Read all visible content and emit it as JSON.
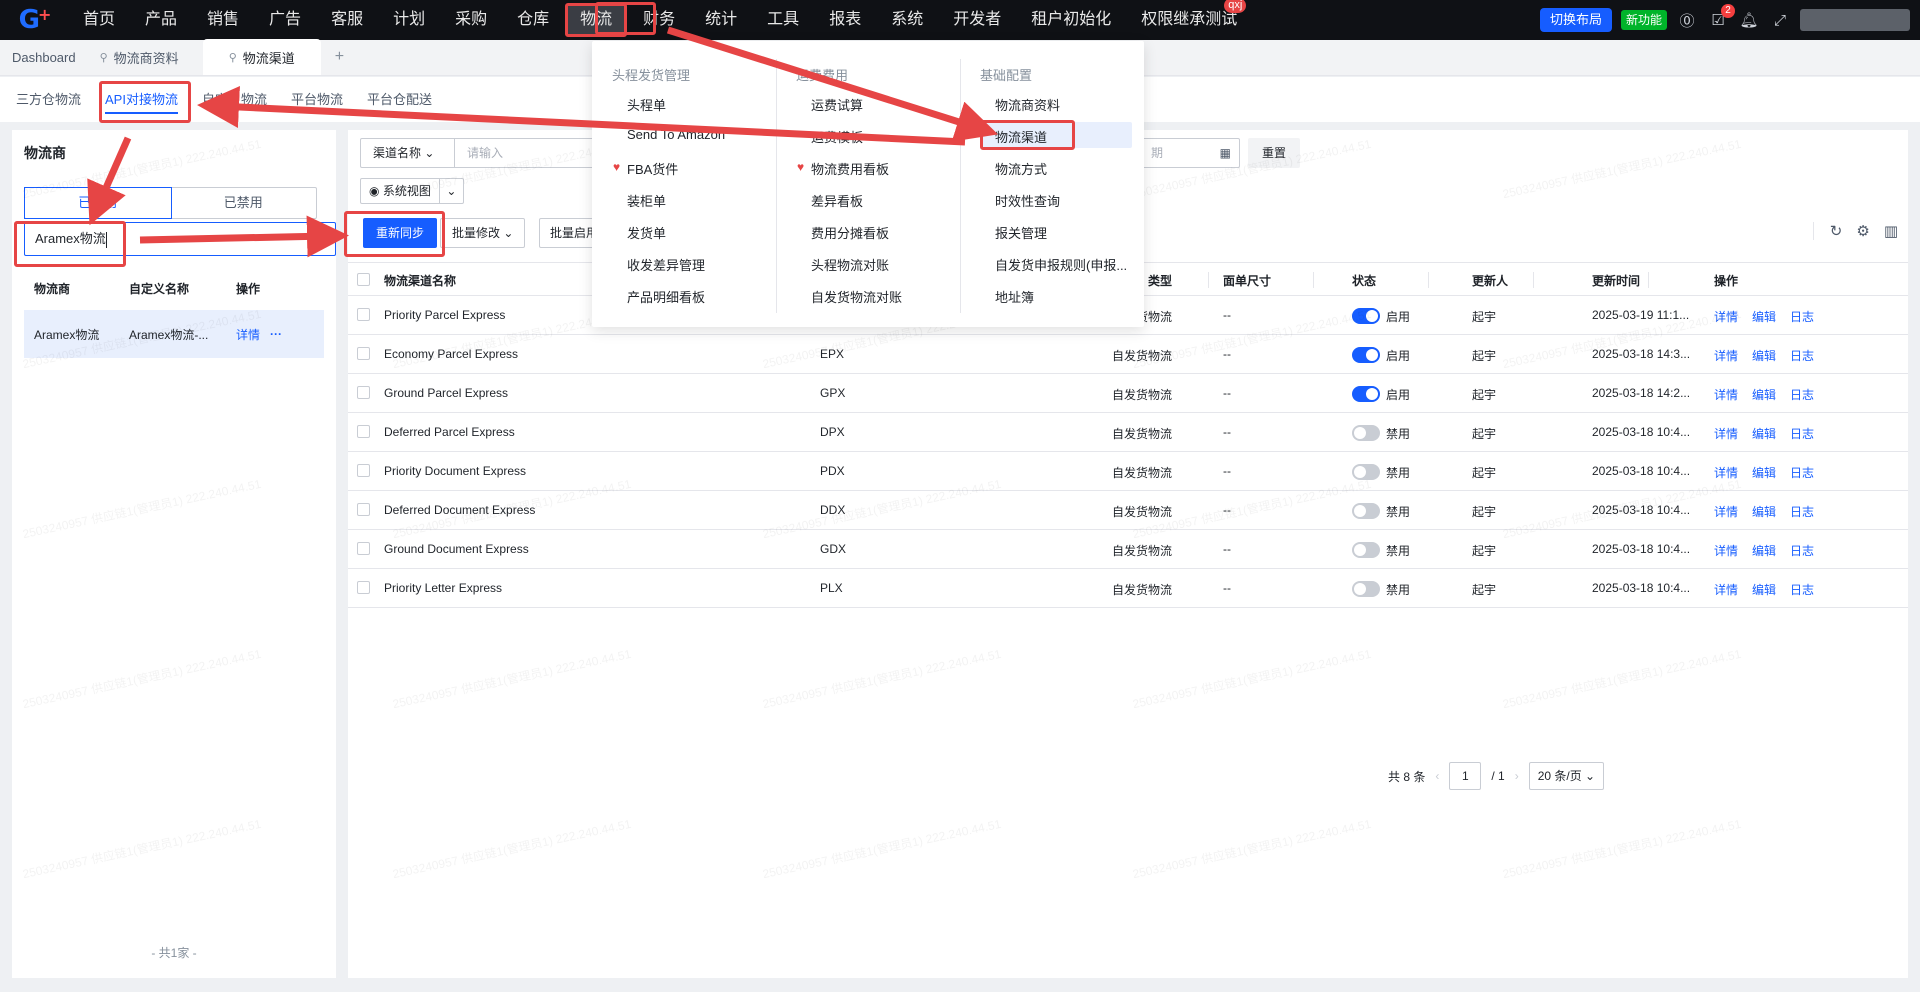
{
  "topnav": {
    "menu": [
      "首页",
      "产品",
      "销售",
      "广告",
      "客服",
      "计划",
      "采购",
      "仓库",
      "物流",
      "财务",
      "统计",
      "工具",
      "报表",
      "系统",
      "开发者",
      "租户初始化",
      "权限继承测试"
    ],
    "active_index": 8,
    "perm_badge": "qxj",
    "switch_layout": "切换布局",
    "new_feature": "新功能",
    "task_badge": "2"
  },
  "tabbar": {
    "tabs": [
      "Dashboard",
      "物流商资料",
      "物流渠道"
    ],
    "current_index": 2
  },
  "subtabs": {
    "items": [
      "三方仓物流",
      "API对接物流",
      "自定义物流",
      "平台物流",
      "平台仓配送"
    ],
    "current_index": 1
  },
  "left": {
    "title": "物流商",
    "seg_enabled": "已启用",
    "seg_disabled": "已禁用",
    "search_value": "Aramex物流",
    "columns": [
      "物流商",
      "自定义名称",
      "操作"
    ],
    "row": {
      "carrier": "Aramex物流",
      "custom": "Aramex物流-...",
      "detail": "详情",
      "more": "···"
    },
    "footer": "- 共1家 -"
  },
  "main": {
    "filter_select": "渠道名称",
    "filter_placeholder": "请输入",
    "date_placeholder": "期",
    "reset": "重置",
    "sys_view": "系统视图",
    "resync": "重新同步",
    "batch_edit": "批量修改",
    "batch_enable": "批量启用",
    "columns": {
      "name": "物流渠道名称",
      "type": "类型",
      "size": "面单尺寸",
      "status": "状态",
      "updater": "更新人",
      "updated": "更新时间",
      "ops": "操作"
    },
    "rows": [
      {
        "name": "Priority Parcel Express",
        "code": "",
        "type": "自发货物流",
        "size": "--",
        "enabled": true,
        "status": "启用",
        "updater": "起宇",
        "time": "2025-03-19 11:1..."
      },
      {
        "name": "Economy Parcel Express",
        "code": "EPX",
        "type": "自发货物流",
        "size": "--",
        "enabled": true,
        "status": "启用",
        "updater": "起宇",
        "time": "2025-03-18 14:3..."
      },
      {
        "name": "Ground Parcel Express",
        "code": "GPX",
        "type": "自发货物流",
        "size": "--",
        "enabled": true,
        "status": "启用",
        "updater": "起宇",
        "time": "2025-03-18 14:2..."
      },
      {
        "name": "Deferred Parcel Express",
        "code": "DPX",
        "type": "自发货物流",
        "size": "--",
        "enabled": false,
        "status": "禁用",
        "updater": "起宇",
        "time": "2025-03-18 10:4..."
      },
      {
        "name": "Priority Document Express",
        "code": "PDX",
        "type": "自发货物流",
        "size": "--",
        "enabled": false,
        "status": "禁用",
        "updater": "起宇",
        "time": "2025-03-18 10:4..."
      },
      {
        "name": "Deferred Document Express",
        "code": "DDX",
        "type": "自发货物流",
        "size": "--",
        "enabled": false,
        "status": "禁用",
        "updater": "起宇",
        "time": "2025-03-18 10:4..."
      },
      {
        "name": "Ground Document Express",
        "code": "GDX",
        "type": "自发货物流",
        "size": "--",
        "enabled": false,
        "status": "禁用",
        "updater": "起宇",
        "time": "2025-03-18 10:4..."
      },
      {
        "name": "Priority Letter Express",
        "code": "PLX",
        "type": "自发货物流",
        "size": "--",
        "enabled": false,
        "status": "禁用",
        "updater": "起宇",
        "time": "2025-03-18 10:4..."
      }
    ],
    "row_actions": [
      "详情",
      "编辑",
      "日志"
    ],
    "pager": {
      "total": "共 8 条",
      "page": "1",
      "pages": "/ 1",
      "page_size": "20 条/页"
    }
  },
  "dropdown": {
    "col1": {
      "header": "头程发货管理",
      "items": [
        "头程单",
        "Send To Amazon",
        "FBA货件",
        "装柜单",
        "发货单",
        "收发差异管理",
        "产品明细看板"
      ]
    },
    "col2": {
      "header": "运费费用",
      "items": [
        "运费试算",
        "运费模板",
        "物流费用看板",
        "差异看板",
        "费用分摊看板",
        "头程物流对账",
        "自发货物流对账"
      ]
    },
    "col3": {
      "header": "基础配置",
      "items": [
        "物流商资料",
        "物流渠道",
        "物流方式",
        "时效性查询",
        "报关管理",
        "自发货申报规则(申报...",
        "地址簿"
      ]
    }
  },
  "watermark": "2503240957 供应链1(管理员1) 222.240.44.51",
  "colors": {
    "accent": "#165dff",
    "annotation": "#e64545",
    "topnav": "#0f1115"
  }
}
